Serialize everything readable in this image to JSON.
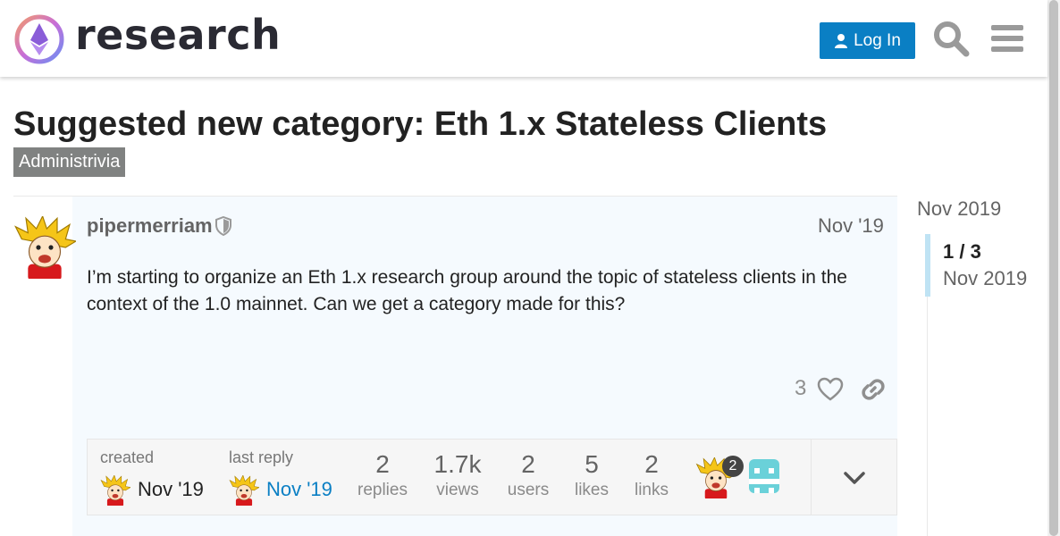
{
  "header": {
    "site_name": "research",
    "login_label": "Log In"
  },
  "colors": {
    "accent": "#0a7fc4",
    "category": "#808281",
    "post_background": "#f5fafe"
  },
  "icons": [
    "logo-icon",
    "user-icon",
    "search-icon",
    "menu-icon",
    "shield-icon",
    "heart-icon",
    "link-icon",
    "chevron-down-icon"
  ],
  "topic": {
    "title": "Suggested new category: Eth 1.x Stateless Clients",
    "category": "Administrivia"
  },
  "post": {
    "username": "pipermerriam",
    "date": "Nov '19",
    "body": "I’m starting to organize an Eth 1.x research group around the topic of stateless clients in the context of the 1.0 mainnet. Can we get a category made for this?",
    "likes": "3"
  },
  "topic_map": {
    "created_label": "created",
    "created_date": "Nov '19",
    "last_reply_label": "last reply",
    "last_reply_date": "Nov '19",
    "stats": [
      {
        "value": "2",
        "label": "replies"
      },
      {
        "value": "1.7k",
        "label": "views"
      },
      {
        "value": "2",
        "label": "users"
      },
      {
        "value": "5",
        "label": "likes"
      },
      {
        "value": "2",
        "label": "links"
      }
    ],
    "participant_post_count": "2"
  },
  "timeline": {
    "top_date": "Nov 2019",
    "counter": "1 / 3",
    "current_date": "Nov 2019"
  }
}
